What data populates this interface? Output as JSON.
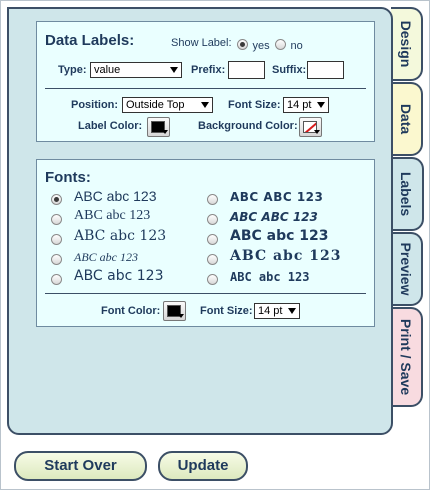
{
  "tabs": [
    {
      "label": "Design",
      "color": "#f4f9dc"
    },
    {
      "label": "Data",
      "color": "#fbf8cf"
    },
    {
      "label": "Labels",
      "color": "#cfe6ea"
    },
    {
      "label": "Preview",
      "color": "#cfe6ea"
    },
    {
      "label": "Print / Save",
      "color": "#f8dbe0"
    }
  ],
  "data_labels": {
    "title": "Data Labels:",
    "show_label": {
      "label": "Show Label:",
      "yes": "yes",
      "no": "no",
      "selected": "yes"
    },
    "type": {
      "label": "Type:",
      "value": "value"
    },
    "prefix": {
      "label": "Prefix:",
      "value": ""
    },
    "suffix": {
      "label": "Suffix:",
      "value": ""
    },
    "position": {
      "label": "Position:",
      "value": "Outside Top"
    },
    "font_size": {
      "label": "Font Size:",
      "value": "14 pt"
    },
    "label_color": {
      "label": "Label Color:",
      "swatch": "#000000"
    },
    "background_color": {
      "label": "Background Color:",
      "swatch": "none"
    }
  },
  "fonts": {
    "title": "Fonts:",
    "selected_index": 0,
    "left": [
      {
        "sample": "ABC abc 123",
        "icon": "font-sans"
      },
      {
        "sample": "ABC abc 123",
        "icon": "font-serif"
      },
      {
        "sample": "ABC abc 123",
        "icon": "font-serif-bold"
      },
      {
        "sample": "ABC abc 123",
        "icon": "font-script"
      },
      {
        "sample": "ABC abc 123",
        "icon": "font-sans-plain"
      }
    ],
    "right": [
      {
        "sample": "ABC ABC 123",
        "icon": "font-decorative-round"
      },
      {
        "sample": "ABC ABC 123",
        "icon": "font-decorative-italic"
      },
      {
        "sample": "ABC abc 123",
        "icon": "font-heavy-sans"
      },
      {
        "sample": "ABC abc 123",
        "icon": "font-wide-serif"
      },
      {
        "sample": "ABC abc 123",
        "icon": "font-block"
      }
    ],
    "font_color": {
      "label": "Font Color:",
      "swatch": "#000000"
    },
    "font_size": {
      "label": "Font Size:",
      "value": "14 pt"
    }
  },
  "buttons": {
    "start_over": "Start Over",
    "update": "Update"
  }
}
